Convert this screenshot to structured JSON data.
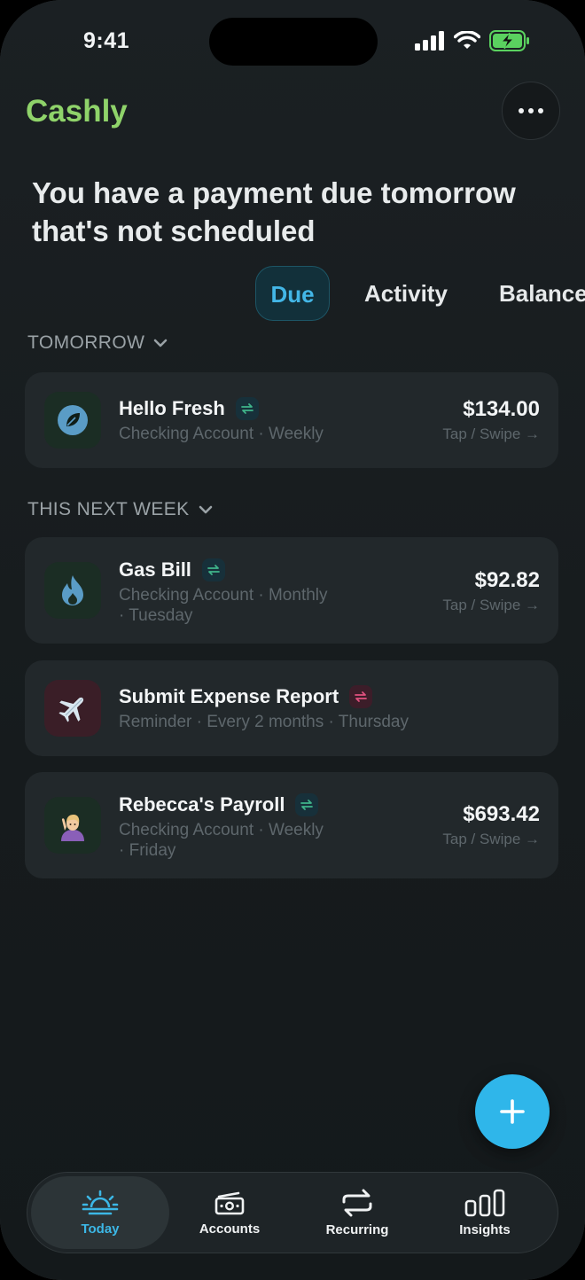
{
  "status_bar": {
    "time": "9:41",
    "icons": [
      "signal-icon",
      "wifi-icon",
      "battery-charging-icon"
    ]
  },
  "app": {
    "name": "Cashly",
    "more_icon": "ellipsis-icon"
  },
  "headline": "You have a payment due tomorrow that's not scheduled",
  "tabs": [
    {
      "label": "Due",
      "selected": true
    },
    {
      "label": "Activity",
      "selected": false
    },
    {
      "label": "Balance",
      "selected": false
    }
  ],
  "sections": {
    "tomorrow": {
      "heading": "TOMORROW",
      "items": [
        {
          "title": "Hello Fresh",
          "subtitle": "Checking Account · Weekly",
          "amount": "$134.00",
          "hint": "Tap / Swipe →",
          "icon": "leaf-icon",
          "recurring": true
        }
      ]
    },
    "next_week": {
      "heading": "THIS NEXT WEEK",
      "items": [
        {
          "title": "Gas Bill",
          "subtitle_line1": "Checking Account · Monthly",
          "subtitle_line2": "· Tuesday",
          "amount": "$92.82",
          "hint": "Tap / Swipe →",
          "icon": "flame-icon",
          "recurring": true
        },
        {
          "title": "Submit Expense Report",
          "subtitle": "Reminder · Every 2 months · Thursday",
          "icon": "airplane-icon",
          "recurring": true
        },
        {
          "title": "Rebecca's Payroll",
          "subtitle_line1": "Checking Account · Weekly",
          "subtitle_line2": "· Friday",
          "amount": "$693.42",
          "hint": "Tap / Swipe →",
          "icon": "person-raising-hand-icon",
          "recurring": true
        }
      ]
    }
  },
  "fab": {
    "icon": "plus-icon"
  },
  "nav": [
    {
      "label": "Today",
      "icon": "sunrise-icon",
      "active": true
    },
    {
      "label": "Accounts",
      "icon": "cash-icon",
      "active": false
    },
    {
      "label": "Recurring",
      "icon": "repeat-icon",
      "active": false
    },
    {
      "label": "Insights",
      "icon": "bar-chart-icon",
      "active": false
    }
  ],
  "colors": {
    "brand": "#8fd36a",
    "accent": "#2fb6ea",
    "background": "#1a1f22",
    "card": "#22282b"
  }
}
